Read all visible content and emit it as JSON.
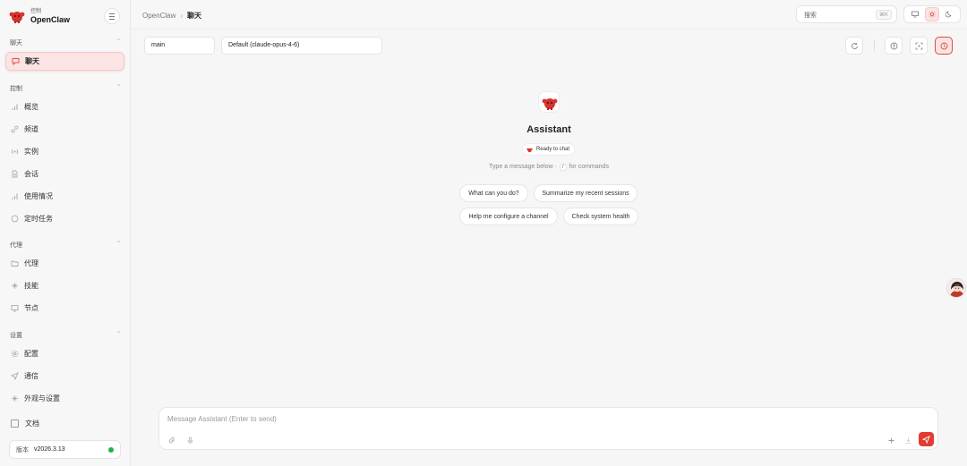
{
  "brand": {
    "subtitle": "控制",
    "name": "OpenClaw"
  },
  "sidebar": {
    "sections": [
      {
        "title": "聊天",
        "items": [
          {
            "label": "聊天",
            "icon": "chat-bubble-icon",
            "active": true
          }
        ]
      },
      {
        "title": "控制",
        "items": [
          {
            "label": "概览",
            "icon": "bar-chart-icon"
          },
          {
            "label": "频道",
            "icon": "link-icon"
          },
          {
            "label": "实例",
            "icon": "radio-icon"
          },
          {
            "label": "会话",
            "icon": "document-icon"
          },
          {
            "label": "使用情况",
            "icon": "bar-chart-icon"
          },
          {
            "label": "定时任务",
            "icon": "clock-icon"
          }
        ]
      },
      {
        "title": "代理",
        "items": [
          {
            "label": "代理",
            "icon": "folder-icon"
          },
          {
            "label": "技能",
            "icon": "sparkle-icon"
          },
          {
            "label": "节点",
            "icon": "monitor-icon"
          }
        ]
      },
      {
        "title": "设置",
        "items": [
          {
            "label": "配置",
            "icon": "gear-icon"
          },
          {
            "label": "通信",
            "icon": "send-icon"
          },
          {
            "label": "外观与设置",
            "icon": "sparkle-icon"
          }
        ]
      }
    ],
    "docs_label": "文档",
    "version_label": "版本",
    "version_value": "v2026.3.13",
    "status_color": "#22b14c"
  },
  "topbar": {
    "breadcrumb_root": "OpenClaw",
    "breadcrumb_current": "聊天",
    "search_placeholder": "搜索",
    "search_shortcut": "⌘K"
  },
  "chat_controls": {
    "session_value": "main",
    "model_value": "Default (claude-opus-4-6)"
  },
  "welcome": {
    "title": "Assistant",
    "status": "Ready to chat",
    "hint_before": "Type a message below ·",
    "hint_key": "/",
    "hint_after": "for commands",
    "suggestions": [
      "What can you do?",
      "Summarize my recent sessions",
      "Help me configure a channel",
      "Check system health"
    ]
  },
  "composer": {
    "placeholder": "Message Assistant (Enter to send)"
  },
  "colors": {
    "accent": "#e23b32",
    "accent_soft": "#fbe4e3",
    "background": "#f6f6f7"
  }
}
